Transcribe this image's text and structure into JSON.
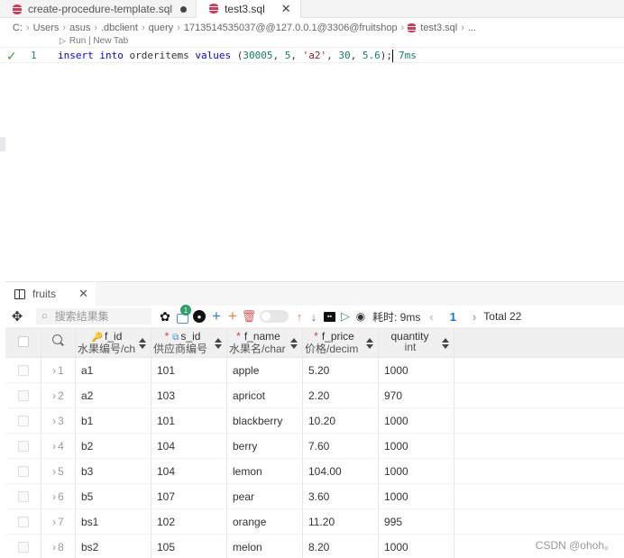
{
  "tabs": [
    {
      "label": "create-procedure-template.sql",
      "modified": true
    },
    {
      "label": "test3.sql",
      "active": true
    }
  ],
  "breadcrumb": [
    "C:",
    "Users",
    "asus",
    ".dbclient",
    "query",
    "1713514535037@@127.0.0.1@3306@fruitshop",
    "test3.sql",
    "..."
  ],
  "codelens": "Run | New Tab",
  "editor": {
    "line_number": "1",
    "tokens": {
      "kw1": "insert",
      "kw2": "into",
      "table": "orderitems",
      "kw3": "values",
      "p_open": "(",
      "n1": "30005",
      "n2": "5",
      "s1": "'a2'",
      "n3": "30",
      "n4": "5.6",
      "p_close": ");",
      "comma": ", "
    },
    "elapsed": "7ms"
  },
  "result": {
    "tab_label": "fruits",
    "search_placeholder": "搜索结果集",
    "badge_count": "1",
    "elapsed": "耗时: 9ms",
    "page": "1",
    "total": "Total 22",
    "columns": [
      {
        "name": "f_id",
        "comment": "水果编号/ch"
      },
      {
        "name": "s_id",
        "comment": "供应商编号"
      },
      {
        "name": "f_name",
        "comment": "水果名/char"
      },
      {
        "name": "f_price",
        "comment": "价格/decim"
      },
      {
        "name": "quantity",
        "comment": "int"
      }
    ],
    "rows": [
      {
        "n": "1",
        "f_id": "a1",
        "s_id": "101",
        "f_name": "apple",
        "f_price": "5.20",
        "quantity": "1000"
      },
      {
        "n": "2",
        "f_id": "a2",
        "s_id": "103",
        "f_name": "apricot",
        "f_price": "2.20",
        "quantity": "970"
      },
      {
        "n": "3",
        "f_id": "b1",
        "s_id": "101",
        "f_name": "blackberry",
        "f_price": "10.20",
        "quantity": "1000"
      },
      {
        "n": "4",
        "f_id": "b2",
        "s_id": "104",
        "f_name": "berry",
        "f_price": "7.60",
        "quantity": "1000"
      },
      {
        "n": "5",
        "f_id": "b3",
        "s_id": "104",
        "f_name": "lemon",
        "f_price": "104.00",
        "quantity": "1000"
      },
      {
        "n": "6",
        "f_id": "b5",
        "s_id": "107",
        "f_name": "pear",
        "f_price": "3.60",
        "quantity": "1000"
      },
      {
        "n": "7",
        "f_id": "bs1",
        "s_id": "102",
        "f_name": "orange",
        "f_price": "11.20",
        "quantity": "995"
      },
      {
        "n": "8",
        "f_id": "bs2",
        "s_id": "105",
        "f_name": "melon",
        "f_price": "8.20",
        "quantity": "1000"
      }
    ]
  },
  "watermark": "CSDN @ohoh。",
  "colors": {
    "keyword": "#0000ff",
    "number": "#098658",
    "string": "#a31515",
    "accent": "#1a6fd6",
    "required": "#d23a57"
  }
}
